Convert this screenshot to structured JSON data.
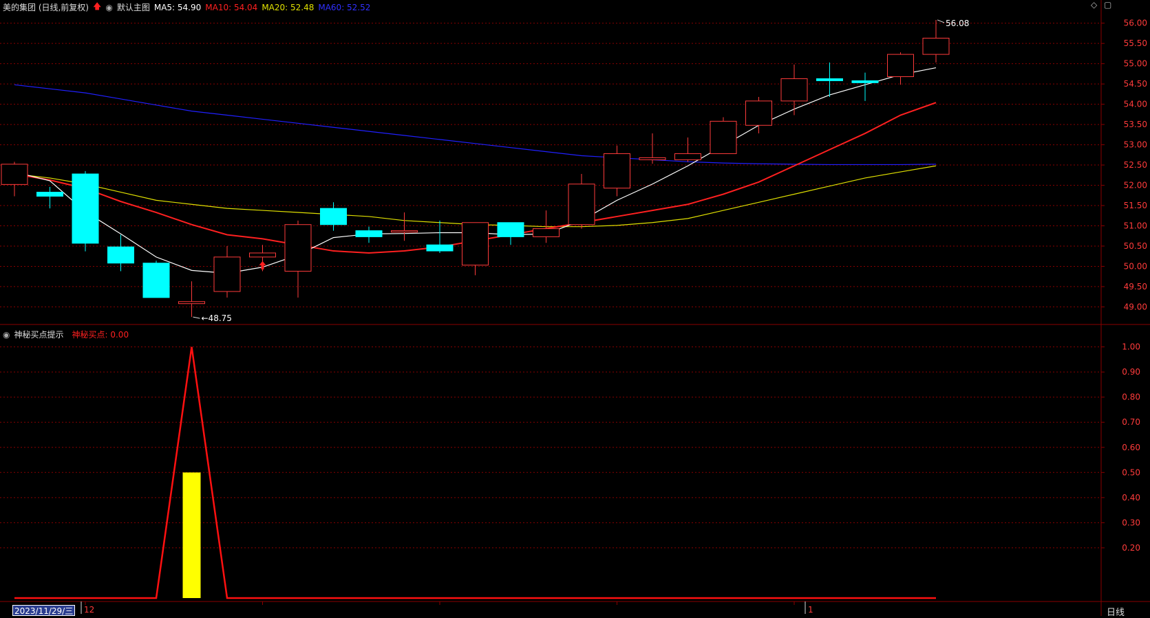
{
  "header": {
    "stock": "美的集团 (日线,前复权)",
    "template": "默认主图",
    "ma5": "MA5: 54.90",
    "ma10": "MA10: 54.04",
    "ma20": "MA20: 52.48",
    "ma60": "MA60: 52.52"
  },
  "indicator": {
    "name": "神秘买点提示",
    "value": "神秘买点: 0.00"
  },
  "footer": {
    "date": "2023/11/29/三",
    "month_labels": [
      "12",
      "1"
    ],
    "period": "日线"
  },
  "colors": {
    "up": "#ff3b3b",
    "down": "#00ffff",
    "ma5": "#ffffff",
    "ma10": "#ff2020",
    "ma20": "#e0e000",
    "ma60": "#2020ff",
    "grid": "#8b0000",
    "axis_text": "#ff3b3b",
    "signal_bar": "#ffff00"
  },
  "chart_data": {
    "type": "candlestick",
    "price_axis": {
      "ticks": [
        "56.00",
        "55.50",
        "55.00",
        "54.50",
        "54.00",
        "53.50",
        "53.00",
        "52.50",
        "52.00",
        "51.50",
        "51.00",
        "50.50",
        "50.00",
        "49.50",
        "49.00"
      ],
      "ylim": [
        48.6,
        56.3
      ]
    },
    "candles": [
      {
        "o": 52.02,
        "h": 52.58,
        "l": 51.73,
        "c": 52.52
      },
      {
        "o": 51.83,
        "h": 51.96,
        "l": 51.43,
        "c": 51.73
      },
      {
        "o": 52.28,
        "h": 52.35,
        "l": 50.37,
        "c": 50.57
      },
      {
        "o": 50.48,
        "h": 50.78,
        "l": 49.88,
        "c": 50.08
      },
      {
        "o": 50.08,
        "h": 50.14,
        "l": 49.23,
        "c": 49.23
      },
      {
        "o": 49.08,
        "h": 49.63,
        "l": 48.75,
        "c": 49.13
      },
      {
        "o": 49.38,
        "h": 50.5,
        "l": 49.23,
        "c": 50.23
      },
      {
        "o": 50.23,
        "h": 50.53,
        "l": 49.88,
        "c": 50.33
      },
      {
        "o": 49.88,
        "h": 51.13,
        "l": 49.23,
        "c": 51.03
      },
      {
        "o": 51.43,
        "h": 51.58,
        "l": 50.88,
        "c": 51.03
      },
      {
        "o": 50.88,
        "h": 50.98,
        "l": 50.58,
        "c": 50.73
      },
      {
        "o": 50.88,
        "h": 51.33,
        "l": 50.63,
        "c": 50.88
      },
      {
        "o": 50.53,
        "h": 51.13,
        "l": 50.33,
        "c": 50.38
      },
      {
        "o": 50.03,
        "h": 51.08,
        "l": 49.78,
        "c": 51.08
      },
      {
        "o": 51.08,
        "h": 51.08,
        "l": 50.53,
        "c": 50.73
      },
      {
        "o": 50.73,
        "h": 51.38,
        "l": 50.58,
        "c": 50.93
      },
      {
        "o": 51.03,
        "h": 52.28,
        "l": 50.93,
        "c": 52.03
      },
      {
        "o": 51.93,
        "h": 52.98,
        "l": 51.73,
        "c": 52.78
      },
      {
        "o": 52.63,
        "h": 53.28,
        "l": 52.53,
        "c": 52.68
      },
      {
        "o": 52.63,
        "h": 53.18,
        "l": 52.58,
        "c": 52.78
      },
      {
        "o": 52.78,
        "h": 53.68,
        "l": 52.78,
        "c": 53.58
      },
      {
        "o": 53.48,
        "h": 54.18,
        "l": 53.28,
        "c": 54.08
      },
      {
        "o": 54.08,
        "h": 54.98,
        "l": 53.73,
        "c": 54.63
      },
      {
        "o": 54.63,
        "h": 55.03,
        "l": 54.18,
        "c": 54.58
      },
      {
        "o": 54.58,
        "h": 54.78,
        "l": 54.08,
        "c": 54.53
      },
      {
        "o": 54.68,
        "h": 55.28,
        "l": 54.48,
        "c": 55.23
      },
      {
        "o": 55.23,
        "h": 56.08,
        "l": 55.03,
        "c": 55.63
      }
    ],
    "ma5": [
      52.33,
      52.11,
      51.35,
      50.8,
      50.23,
      49.9,
      49.83,
      49.98,
      50.28,
      50.71,
      50.8,
      50.81,
      50.83,
      50.83,
      50.78,
      50.8,
      51.13,
      51.63,
      52.03,
      52.48,
      52.98,
      53.48,
      53.88,
      54.23,
      54.48,
      54.73,
      54.9
    ],
    "ma10": [
      52.28,
      52.13,
      51.92,
      51.6,
      51.33,
      51.03,
      50.78,
      50.68,
      50.53,
      50.38,
      50.33,
      50.38,
      50.48,
      50.63,
      50.78,
      50.93,
      51.08,
      51.23,
      51.38,
      51.53,
      51.78,
      52.08,
      52.48,
      52.88,
      53.28,
      53.73,
      54.04
    ],
    "ma20": [
      52.28,
      52.18,
      52.03,
      51.83,
      51.63,
      51.53,
      51.43,
      51.38,
      51.33,
      51.28,
      51.23,
      51.13,
      51.08,
      51.03,
      51.01,
      50.98,
      50.98,
      51.01,
      51.08,
      51.18,
      51.38,
      51.58,
      51.78,
      51.98,
      52.18,
      52.33,
      52.48
    ],
    "ma60": [
      54.48,
      54.38,
      54.28,
      54.13,
      53.98,
      53.83,
      53.73,
      53.63,
      53.53,
      53.43,
      53.33,
      53.23,
      53.13,
      53.03,
      52.93,
      52.83,
      52.73,
      52.68,
      52.63,
      52.58,
      52.55,
      52.53,
      52.52,
      52.51,
      52.51,
      52.51,
      52.52
    ],
    "labels": {
      "high": "56.08",
      "low": "48.75"
    },
    "buy_marker_index": 7,
    "indicator_axis": {
      "ticks": [
        "1.00",
        "0.90",
        "0.80",
        "0.70",
        "0.60",
        "0.50",
        "0.40",
        "0.30",
        "0.20"
      ],
      "ylim": [
        0,
        1.04
      ]
    },
    "signal_line": [
      0,
      0,
      0,
      0,
      0,
      1,
      0,
      0,
      0,
      0,
      0,
      0,
      0,
      0,
      0,
      0,
      0,
      0,
      0,
      0,
      0,
      0,
      0,
      0,
      0,
      0,
      0
    ],
    "signal_bar": [
      0,
      0,
      0,
      0,
      0,
      0.5,
      0,
      0,
      0,
      0,
      0,
      0,
      0,
      0,
      0,
      0,
      0,
      0,
      0,
      0,
      0,
      0,
      0,
      0,
      0,
      0,
      0
    ]
  }
}
